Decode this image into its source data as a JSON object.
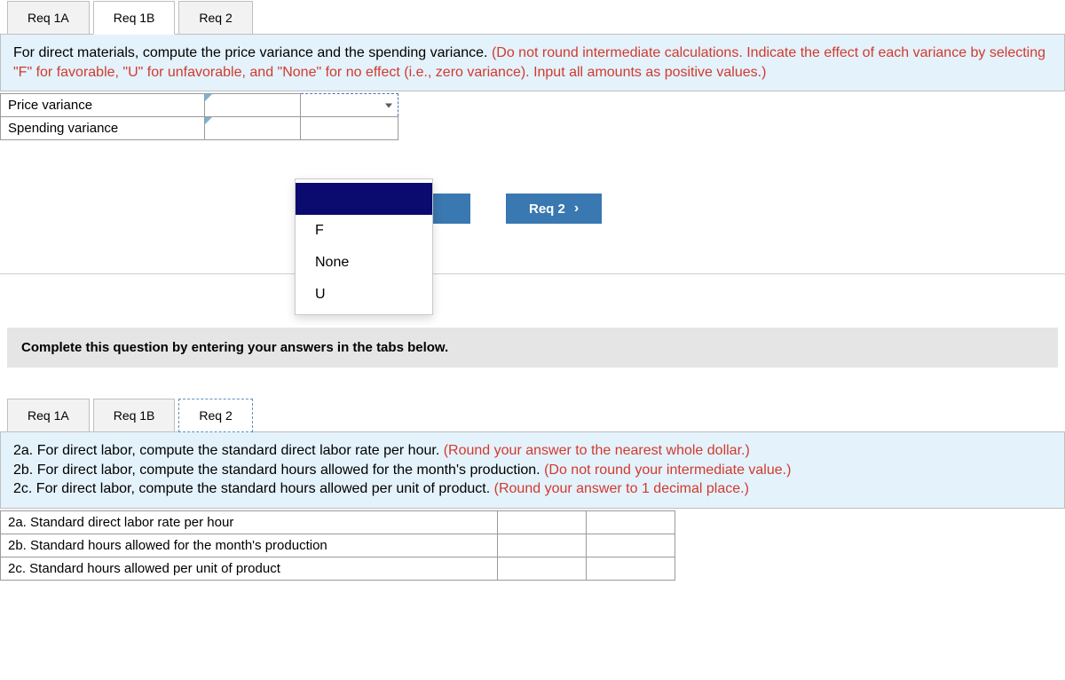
{
  "section1": {
    "tabs": [
      "Req 1A",
      "Req 1B",
      "Req 2"
    ],
    "active_tab_index": 1,
    "prompt_black": "For direct materials, compute the price variance and the spending variance. ",
    "prompt_red": "(Do not round intermediate calculations. Indicate the effect of each variance by selecting \"F\" for favorable, \"U\" for unfavorable, and \"None\" for no effect (i.e., zero variance). Input all amounts as positive values.)",
    "rows": [
      {
        "label": "Price variance",
        "value": "",
        "effect": ""
      },
      {
        "label": "Spending variance",
        "value": "",
        "effect": ""
      }
    ],
    "dropdown_options": [
      "",
      "F",
      "None",
      "U"
    ],
    "dropdown_selected_index": 0,
    "next_button": "Req 2"
  },
  "section2": {
    "banner": "Complete this question by entering your answers in the tabs below.",
    "tabs": [
      "Req 1A",
      "Req 1B",
      "Req 2"
    ],
    "dashed_tab_index": 2,
    "prompt_lines": [
      {
        "black": "2a. For direct labor, compute the standard direct labor rate per hour. ",
        "red": "(Round your answer to the nearest whole dollar.)"
      },
      {
        "black": "2b. For direct labor, compute the standard hours allowed for the month's production. ",
        "red": "(Do not round your intermediate value.)"
      },
      {
        "black": "2c. For direct labor, compute the standard hours allowed per unit of product. ",
        "red": "(Round your answer to 1 decimal place.)"
      }
    ],
    "rows": [
      {
        "label": "2a. Standard direct labor rate per hour",
        "left": "",
        "right": ""
      },
      {
        "label": "2b. Standard hours allowed for the month's production",
        "left": "",
        "right": ""
      },
      {
        "label": "2c. Standard hours allowed per unit of product",
        "left": "",
        "right": ""
      }
    ]
  }
}
